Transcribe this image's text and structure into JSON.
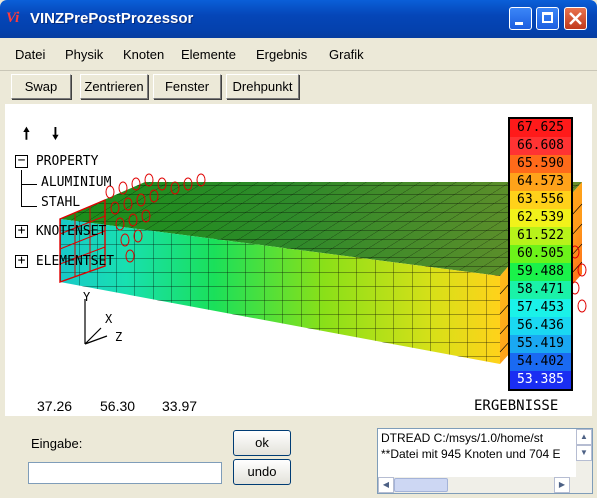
{
  "window": {
    "title": "VINZPrePostProzessor",
    "icon_glyph": "Vi"
  },
  "menu": [
    "Datei",
    "Physik",
    "Knoten",
    "Elemente",
    "Ergebnis",
    "Grafik"
  ],
  "toolbar": [
    "Swap",
    "Zentrieren",
    "Fenster",
    "Drehpunkt"
  ],
  "tree": {
    "arrows": {
      "up": "🠕",
      "down": "🠗"
    },
    "property": "PROPERTY",
    "children": [
      "ALUMINIUM",
      "STAHL"
    ],
    "knotenset": "KNOTENSET",
    "elementset": "ELEMENTSET"
  },
  "axes": {
    "x": "X",
    "y": "Y",
    "z": "Z"
  },
  "coords": [
    "37.26",
    "56.30",
    "33.97"
  ],
  "results_label": "ERGEBNISSE",
  "legend": {
    "values": [
      "67.625",
      "66.608",
      "65.590",
      "64.573",
      "63.556",
      "62.539",
      "61.522",
      "60.505",
      "59.488",
      "58.471",
      "57.453",
      "56.436",
      "55.419",
      "54.402",
      "53.385"
    ],
    "colors": [
      "#ff1a1a",
      "#ff3333",
      "#ff6a1a",
      "#ffa31a",
      "#ffd11a",
      "#f2f21a",
      "#b8f21a",
      "#6cf21a",
      "#1af24a",
      "#1af2a8",
      "#1af2e8",
      "#1ad8f2",
      "#1aa8f2",
      "#1a6af2",
      "#1a2ef2"
    ]
  },
  "bottom": {
    "input_label": "Eingabe:",
    "input_value": "",
    "ok_label": "ok",
    "undo_label": "undo",
    "log": [
      "DTREAD C:/msys/1.0/home/st",
      "**Datei mit 945 Knoten und 704 E"
    ]
  }
}
